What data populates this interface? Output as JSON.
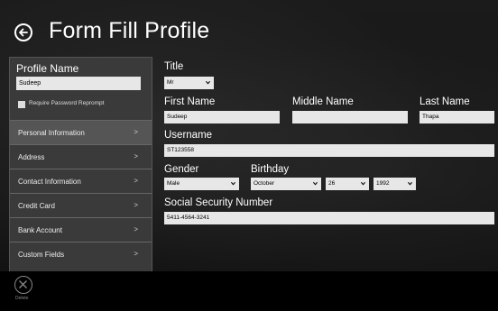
{
  "header": {
    "title": "Form Fill Profile"
  },
  "profile": {
    "name_label": "Profile Name",
    "name_value": "Sudeep",
    "reprompt_label": "Require Password Reprompt"
  },
  "nav": {
    "items": [
      {
        "label": "Personal Information",
        "chevron": ">"
      },
      {
        "label": "Address",
        "chevron": ">"
      },
      {
        "label": "Contact Information",
        "chevron": ">"
      },
      {
        "label": "Credit Card",
        "chevron": ">"
      },
      {
        "label": "Bank Account",
        "chevron": ">"
      },
      {
        "label": "Custom Fields",
        "chevron": ">"
      }
    ]
  },
  "form": {
    "title_label": "Title",
    "title_value": "Mr",
    "first_name_label": "First Name",
    "first_name_value": "Sudeep",
    "middle_name_label": "Middle Name",
    "middle_name_value": "",
    "last_name_label": "Last Name",
    "last_name_value": "Thapa",
    "username_label": "Username",
    "username_value": "ST123558",
    "gender_label": "Gender",
    "gender_value": "Male",
    "birthday_label": "Birthday",
    "birth_month": "October",
    "birth_day": "26",
    "birth_year": "1992",
    "ssn_label": "Social Security Number",
    "ssn_value": "5411-4564-3241"
  },
  "appbar": {
    "delete_label": "Delete"
  }
}
